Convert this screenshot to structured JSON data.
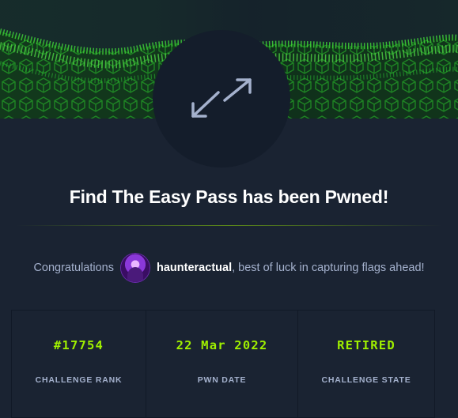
{
  "banner": {
    "icon": "expand-arrows-icon",
    "accent_color": "#9fef00"
  },
  "title": "Find The Easy Pass has been Pwned!",
  "congrats": {
    "prefix": "Congratulations",
    "username": "haunteractual",
    "suffix": ", best of luck in capturing flags ahead!"
  },
  "stats": [
    {
      "value": "#17754",
      "label": "CHALLENGE RANK"
    },
    {
      "value": "22 Mar 2022",
      "label": "PWN DATE"
    },
    {
      "value": "RETIRED",
      "label": "CHALLENGE STATE"
    }
  ],
  "colors": {
    "background": "#1a2332",
    "banner": "#141d2b",
    "accent": "#9fef00",
    "muted_text": "#a4b1cd"
  }
}
